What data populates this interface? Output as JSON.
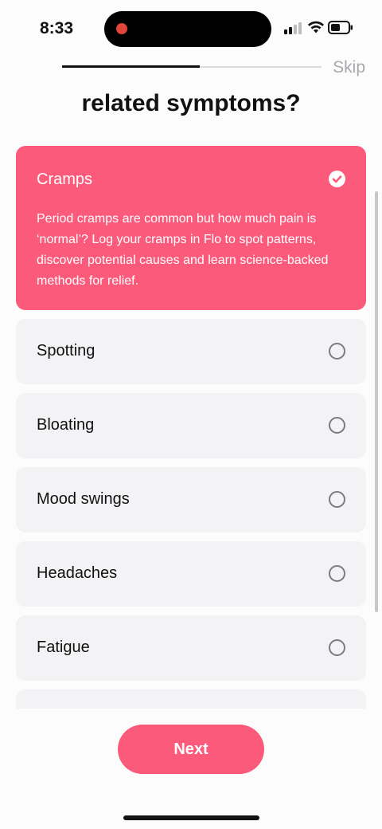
{
  "status_bar": {
    "time": "8:33"
  },
  "header": {
    "skip_label": "Skip",
    "progress_fraction": 0.53
  },
  "title": "related symptoms?",
  "selected_option": {
    "label": "Cramps",
    "description": "Period cramps are common but how much pain is ‘normal’? Log your cramps in Flo to spot patterns, discover potential causes and learn science-backed methods for relief."
  },
  "options": [
    {
      "label": "Spotting"
    },
    {
      "label": "Bloating"
    },
    {
      "label": "Mood swings"
    },
    {
      "label": "Headaches"
    },
    {
      "label": "Fatigue"
    }
  ],
  "footer": {
    "next_label": "Next"
  },
  "colors": {
    "accent": "#fc5a7b",
    "card": "#f3f2f5"
  },
  "icons": [
    "record-indicator-icon",
    "cellular-signal-icon",
    "wifi-icon",
    "battery-icon",
    "checkmark-icon",
    "radio-unselected-icon"
  ]
}
